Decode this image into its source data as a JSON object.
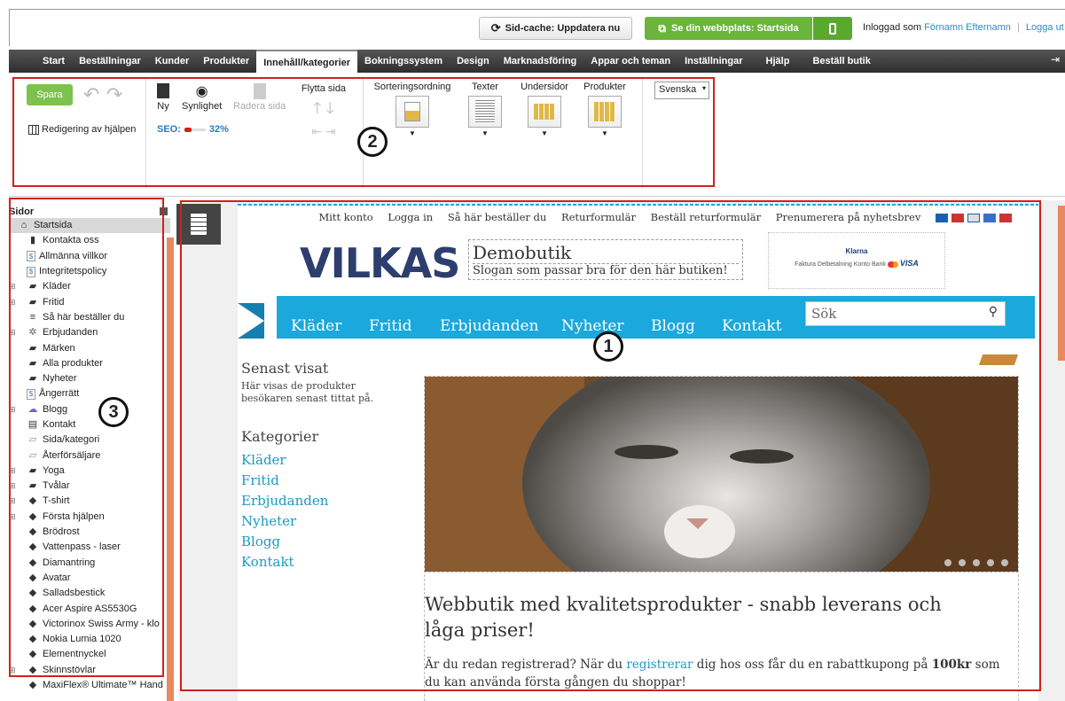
{
  "topbar": {
    "cache_button": "Sid-cache: Uppdatera nu",
    "site_button": "Se din webbplats: Startsida",
    "logged_in_prefix": "Inloggad som",
    "user_name": "Förnamn Efternamn",
    "logout": "Logga ut"
  },
  "menu": [
    "Start",
    "Beställningar",
    "Kunder",
    "Produkter",
    "Innehåll/kategorier",
    "Bokningssystem",
    "Design",
    "Marknadsföring",
    "Appar och teman",
    "Inställningar",
    "Hjälp",
    "Beställ butik"
  ],
  "ribbon": {
    "save": "Spara",
    "help_edit": "Redigering av hjälpen",
    "new": "Ny",
    "visibility": "Synlighet",
    "delete_page": "Radera sida",
    "seo_label": "SEO:",
    "seo_value": "32%",
    "seo_fraction": 0.32,
    "move_page": "Flytta sida",
    "sorting": "Sorteringsordning",
    "texts": "Texter",
    "subpages": "Undersidor",
    "products": "Produkter",
    "language": "Svenska"
  },
  "sidebar": {
    "title": "Sidor",
    "items": [
      {
        "label": "Startsida",
        "icon": "home-icon",
        "exp": "",
        "level": 0
      },
      {
        "label": "Kontakta oss",
        "icon": "page-icon",
        "exp": "",
        "level": 1
      },
      {
        "label": "Allmänna villkor",
        "icon": "dollar-page-icon",
        "exp": "",
        "level": 1
      },
      {
        "label": "Integritetspolicy",
        "icon": "dollar-page-icon",
        "exp": "",
        "level": 1
      },
      {
        "label": "Kläder",
        "icon": "folder-icon",
        "exp": "⊞",
        "level": 1
      },
      {
        "label": "Fritid",
        "icon": "folder-icon",
        "exp": "⊞",
        "level": 1
      },
      {
        "label": "Så här beställer du",
        "icon": "text-page-icon",
        "exp": "",
        "level": 1
      },
      {
        "label": "Erbjudanden",
        "icon": "star-icon",
        "exp": "⊞",
        "level": 1
      },
      {
        "label": "Märken",
        "icon": "folder-icon",
        "exp": "",
        "level": 1
      },
      {
        "label": "Alla produkter",
        "icon": "folder-icon",
        "exp": "",
        "level": 1
      },
      {
        "label": "Nyheter",
        "icon": "folder-icon",
        "exp": "",
        "level": 1
      },
      {
        "label": "Ångerrätt",
        "icon": "dollar-page-icon",
        "exp": "",
        "level": 1
      },
      {
        "label": "Blogg",
        "icon": "blog-icon",
        "exp": "⊞",
        "level": 1
      },
      {
        "label": "Kontakt",
        "icon": "form-icon",
        "exp": "",
        "level": 1
      },
      {
        "label": "Sida/kategori",
        "icon": "folder-grey-icon",
        "exp": "",
        "level": 1
      },
      {
        "label": "Återförsäljare",
        "icon": "folder-grey-icon",
        "exp": "",
        "level": 1
      },
      {
        "label": "Yoga",
        "icon": "folder-icon",
        "exp": "⊞",
        "level": 1
      },
      {
        "label": "Tvålar",
        "icon": "folder-icon",
        "exp": "⊞",
        "level": 1
      },
      {
        "label": "T-shirt",
        "icon": "product-icon",
        "exp": "⊞",
        "level": 1
      },
      {
        "label": "Första hjälpen",
        "icon": "product-icon",
        "exp": "⊞",
        "level": 1
      },
      {
        "label": "Brödrost",
        "icon": "product-icon",
        "exp": "",
        "level": 1
      },
      {
        "label": "Vattenpass - laser",
        "icon": "product-icon",
        "exp": "",
        "level": 1
      },
      {
        "label": "Diamantring",
        "icon": "product-icon",
        "exp": "",
        "level": 1
      },
      {
        "label": "Avatar",
        "icon": "product-icon",
        "exp": "",
        "level": 1
      },
      {
        "label": "Salladsbestick",
        "icon": "product-icon",
        "exp": "",
        "level": 1
      },
      {
        "label": "Acer Aspire AS5530G",
        "icon": "product-icon",
        "exp": "",
        "level": 1
      },
      {
        "label": "Victorinox Swiss Army - klo",
        "icon": "product-icon",
        "exp": "",
        "level": 1
      },
      {
        "label": "Nokia Lumia 1020",
        "icon": "product-icon",
        "exp": "",
        "level": 1
      },
      {
        "label": "Elementnyckel",
        "icon": "product-icon",
        "exp": "",
        "level": 1
      },
      {
        "label": "Skinnstövlar",
        "icon": "product-icon",
        "exp": "⊞",
        "level": 1
      },
      {
        "label": "MaxiFlex® Ultimate™ Hand",
        "icon": "product-icon",
        "exp": "",
        "level": 1
      }
    ]
  },
  "site": {
    "top_links": [
      "Mitt konto",
      "Logga in",
      "Så här beställer du",
      "Returformulär",
      "Beställ returformulär",
      "Prenumerera på nyhetsbrev"
    ],
    "logo": "VILKAS",
    "shop_name": "Demobutik",
    "slogan": "Slogan som passar bra för den här butiken!",
    "klarna_title": "Klarna",
    "klarna_items": "Faktura  Delbetalning  Konto  Bank",
    "visa": "VISA",
    "nav": [
      "Kläder",
      "Fritid",
      "Erbjudanden",
      "Nyheter",
      "Blogg",
      "Kontakt"
    ],
    "search_placeholder": "Sök",
    "recent_title": "Senast visat",
    "recent_text": "Här visas de produkter besökaren senast tittat på.",
    "categories_title": "Kategorier",
    "categories": [
      "Kläder",
      "Fritid",
      "Erbjudanden",
      "Nyheter",
      "Blogg",
      "Kontakt"
    ],
    "headline": "Webbutik med kvalitetsprodukter - snabb leverans och låga priser!",
    "para_1": "Är du redan registrerad? När du ",
    "para_link": "registrerar",
    "para_2": " dig hos oss får du en rabattkupong på ",
    "para_bold": "100kr",
    "para_3": " som du kan använda första gången du shoppar!"
  },
  "annotations": [
    "1",
    "2",
    "3"
  ],
  "colors": {
    "accent_green": "#6ab53a",
    "menu_dark": "#333333",
    "nav_blue": "#1ba8dc",
    "highlight_red": "#d0211b",
    "sidebar_orange": "#e8895f"
  }
}
